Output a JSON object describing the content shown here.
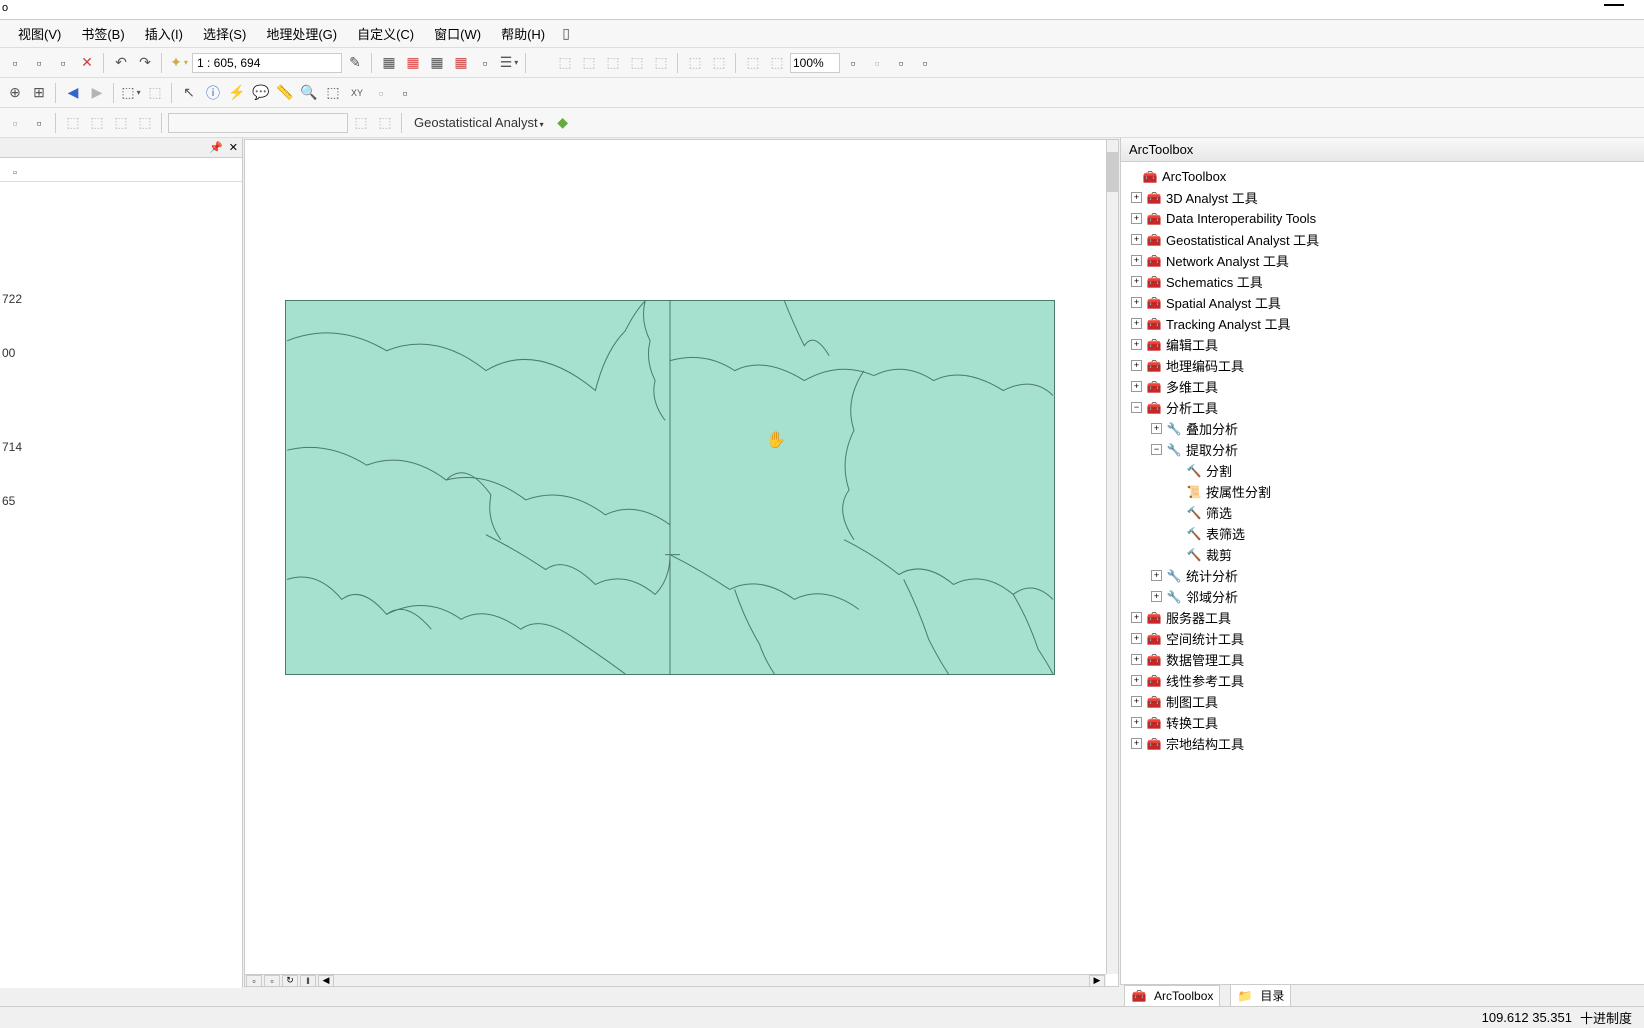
{
  "menu": {
    "view": "视图(V)",
    "bookmarks": "书签(B)",
    "insert": "插入(I)",
    "selection": "选择(S)",
    "geoprocessing": "地理处理(G)",
    "customize": "自定义(C)",
    "window": "窗口(W)",
    "help": "帮助(H)"
  },
  "toolbar": {
    "scale": "1 : 605, 694",
    "zoom": "100%",
    "geo_analyst": "Geostatistical Analyst"
  },
  "left": {
    "v1": "722",
    "v2": "00",
    "v3": "714",
    "v4": "65"
  },
  "right": {
    "title": "ArcToolbox",
    "root": "ArcToolbox",
    "items": {
      "t3d": "3D Analyst 工具",
      "data_interop": "Data Interoperability Tools",
      "geo": "Geostatistical Analyst 工具",
      "network": "Network Analyst 工具",
      "schematics": "Schematics 工具",
      "spatial": "Spatial Analyst 工具",
      "tracking": "Tracking Analyst 工具",
      "editing": "编辑工具",
      "geocoding": "地理编码工具",
      "multidim": "多维工具",
      "analysis": "分析工具",
      "overlay": "叠加分析",
      "extract": "提取分析",
      "split": "分割",
      "split_attr": "按属性分割",
      "select": "筛选",
      "table_select": "表筛选",
      "clip": "裁剪",
      "statistics": "统计分析",
      "proximity": "邻域分析",
      "server": "服务器工具",
      "spatial_stats": "空间统计工具",
      "data_mgmt": "数据管理工具",
      "linear_ref": "线性参考工具",
      "cartography": "制图工具",
      "conversion": "转换工具",
      "parcel": "宗地结构工具"
    }
  },
  "bottom_tabs": {
    "arctoolbox": "ArcToolbox",
    "catalog": "目录"
  },
  "status": {
    "coords": "109.612  35.351",
    "units": "十进制度"
  },
  "expander": {
    "plus": "+",
    "minus": "−"
  }
}
